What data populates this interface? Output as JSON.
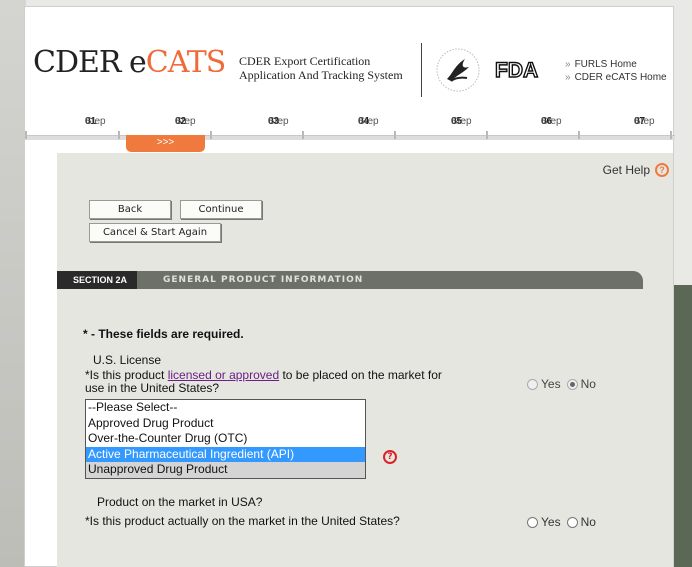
{
  "header": {
    "logo_prefix": "CDER e",
    "logo_accent": "CATS",
    "system_title_line1": "CDER Export Certification",
    "system_title_line2": "Application And Tracking System",
    "links": [
      "FURLS Home",
      "CDER eCATS Home"
    ],
    "link_arrow": "»",
    "fda_logo": "FDA"
  },
  "steps": [
    {
      "prefix": "Step ",
      "num": "01"
    },
    {
      "prefix": "Step ",
      "num": "02"
    },
    {
      "prefix": "Step ",
      "num": "03"
    },
    {
      "prefix": "Step ",
      "num": "04"
    },
    {
      "prefix": "Step ",
      "num": "05"
    },
    {
      "prefix": "Step ",
      "num": "06"
    },
    {
      "prefix": "Step ",
      "num": "07"
    }
  ],
  "current_step_marker": ">>>",
  "help": {
    "label": "Get Help",
    "icon": "?"
  },
  "buttons": {
    "back": "Back",
    "continue": "Continue",
    "cancel": "Cancel & Start Again"
  },
  "section": {
    "tag": "SECTION 2A",
    "title": "GENERAL PRODUCT INFORMATION"
  },
  "required_note": "* - These fields are required.",
  "us_license": {
    "title": "U.S. License",
    "question_prefix": "*Is this product ",
    "question_link": "licensed or approved",
    "question_suffix": " to be placed on the market for",
    "question_line2": "use in the United States?",
    "yes": "Yes",
    "no": "No",
    "selected": "No"
  },
  "product_type_select": {
    "options": [
      "--Please Select--",
      "Approved Drug Product",
      "Over-the-Counter Drug (OTC)",
      "Active Pharmaceutical Ingredient (API)",
      "Unapproved Drug Product"
    ],
    "selected": "Active Pharmaceutical Ingredient (API)"
  },
  "field_help_icon": "?",
  "on_market": {
    "title": "Product on the market in USA?",
    "question": "*Is this product actually on the market in the United States?",
    "yes": "Yes",
    "no": "No",
    "selected": ""
  },
  "colors": {
    "accent": "#f07a3e",
    "section_bar": "#6c7068",
    "selected_option": "#3399ff"
  }
}
